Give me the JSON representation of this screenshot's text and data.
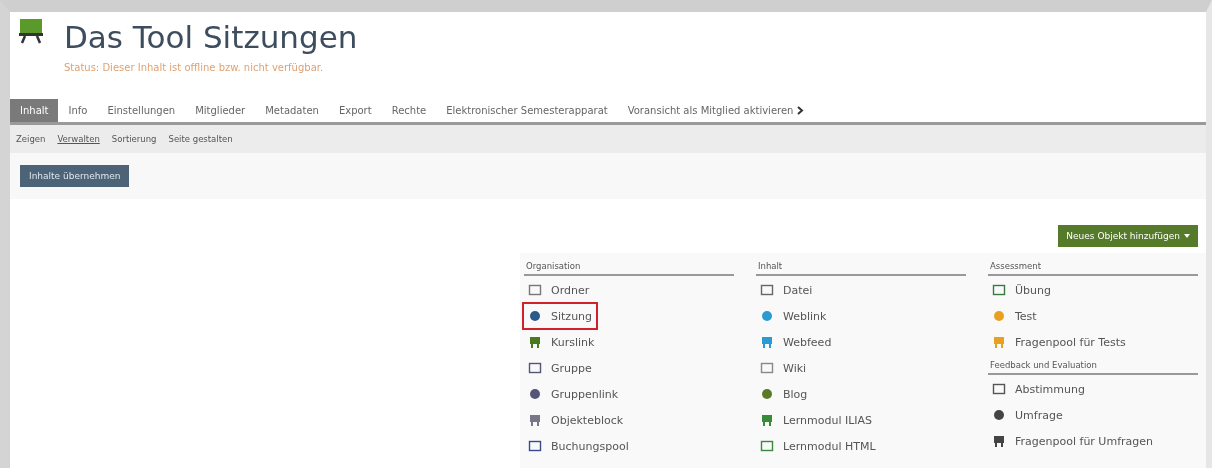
{
  "header": {
    "title": "Das Tool Sitzungen",
    "status": "Status: Dieser Inhalt ist offline bzw. nicht verfügbar."
  },
  "tabs": [
    {
      "label": "Inhalt",
      "selected": true
    },
    {
      "label": "Info",
      "selected": false
    },
    {
      "label": "Einstellungen",
      "selected": false
    },
    {
      "label": "Mitglieder",
      "selected": false
    },
    {
      "label": "Metadaten",
      "selected": false
    },
    {
      "label": "Export",
      "selected": false
    },
    {
      "label": "Rechte",
      "selected": false
    },
    {
      "label": "Elektronischer Semesterapparat",
      "selected": false
    },
    {
      "label": "Voransicht als Mitglied aktivieren",
      "selected": false
    }
  ],
  "subtabs": [
    {
      "label": "Zeigen",
      "selected": false
    },
    {
      "label": "Verwalten",
      "selected": true
    },
    {
      "label": "Sortierung",
      "selected": false
    },
    {
      "label": "Seite gestalten",
      "selected": false
    }
  ],
  "take_over_button": "Inhalte übernehmen",
  "add_button": "Neues Objekt hinzufügen",
  "menu": {
    "columns": [
      {
        "groups": [
          {
            "heading": "Organisation",
            "items": [
              {
                "label": "Ordner",
                "highlighted": false
              },
              {
                "label": "Sitzung",
                "highlighted": true
              },
              {
                "label": "Kurslink",
                "highlighted": false
              },
              {
                "label": "Gruppe",
                "highlighted": false
              },
              {
                "label": "Gruppenlink",
                "highlighted": false
              },
              {
                "label": "Objekteblock",
                "highlighted": false
              },
              {
                "label": "Buchungspool",
                "highlighted": false
              }
            ]
          }
        ]
      },
      {
        "groups": [
          {
            "heading": "Inhalt",
            "items": [
              {
                "label": "Datei",
                "highlighted": false
              },
              {
                "label": "Weblink",
                "highlighted": false
              },
              {
                "label": "Webfeed",
                "highlighted": false
              },
              {
                "label": "Wiki",
                "highlighted": false
              },
              {
                "label": "Blog",
                "highlighted": false
              },
              {
                "label": "Lernmodul ILIAS",
                "highlighted": false
              },
              {
                "label": "Lernmodul HTML",
                "highlighted": false
              }
            ]
          }
        ]
      },
      {
        "groups": [
          {
            "heading": "Assessment",
            "items": [
              {
                "label": "Übung",
                "highlighted": false
              },
              {
                "label": "Test",
                "highlighted": false
              },
              {
                "label": "Fragenpool für Tests",
                "highlighted": false
              }
            ]
          },
          {
            "heading": "Feedback und Evaluation",
            "items": [
              {
                "label": "Abstimmung",
                "highlighted": false
              },
              {
                "label": "Umfrage",
                "highlighted": false
              },
              {
                "label": "Fragenpool für Umfragen",
                "highlighted": false
              }
            ]
          }
        ]
      }
    ]
  }
}
